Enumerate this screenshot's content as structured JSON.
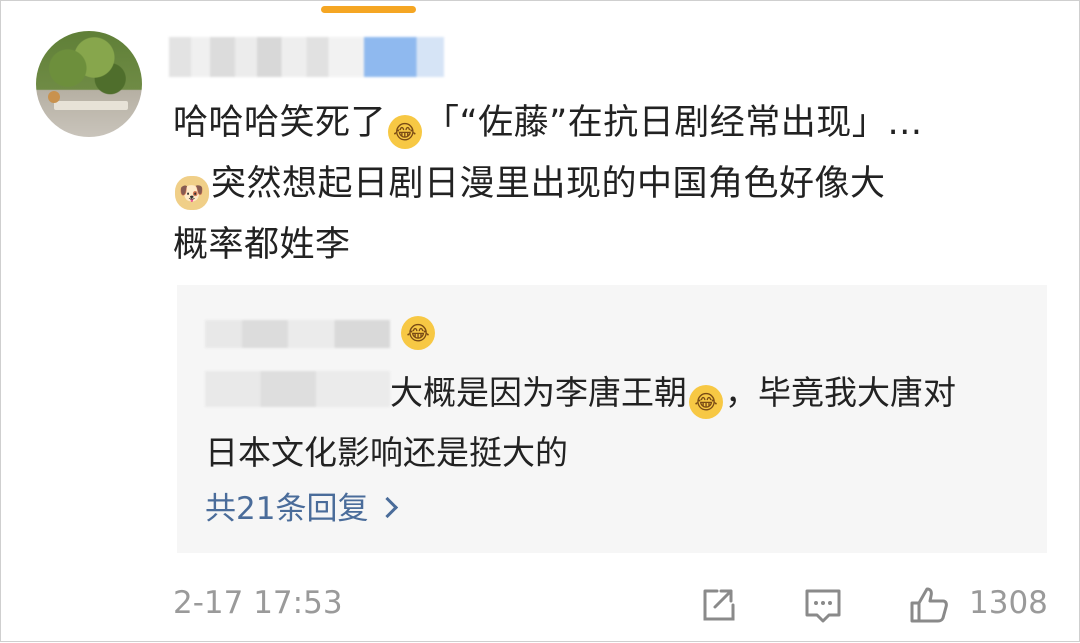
{
  "comment": {
    "text": "哈哈哈笑死了😂「“佐藤”在抗日剧经常出现」…🐶突然想起日剧日漫里出现的中国角色好像大概率都姓李",
    "line1": "哈哈哈笑死了",
    "line1b": "「“佐藤”在抗日剧经常出现」…",
    "line2": "突然想起日剧日漫里出现的中国角色好像大",
    "line3": "概率都姓李",
    "emoji1": "😂",
    "emoji2": "🐶"
  },
  "reply": {
    "emoji": "😂",
    "line1a": "大概是因为李唐王朝",
    "line1b": "，毕竟我大唐对",
    "line2": "日本文化影响还是挺大的",
    "more": "共21条回复"
  },
  "footer": {
    "timestamp": "2-17 17:53",
    "like_count": "1308"
  },
  "icons": [
    "share-icon",
    "comment-icon",
    "like-icon",
    "chevron-right-icon",
    "avatar"
  ],
  "colors": {
    "accent": "#f5a623",
    "link": "#4a6c9a",
    "meta": "#9a9a9a",
    "reply_bg": "#f6f6f6"
  }
}
